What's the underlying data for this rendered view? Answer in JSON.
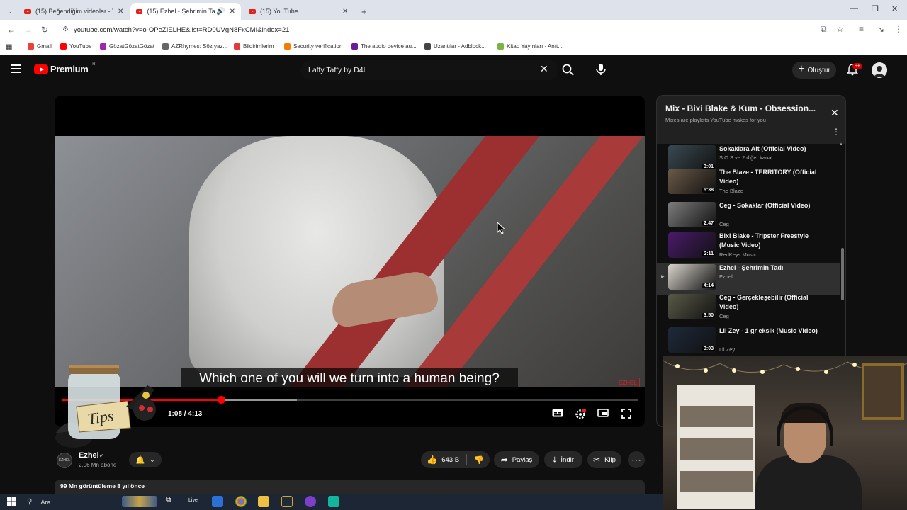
{
  "browser": {
    "tabs": [
      {
        "label": "(15) Beğendiğim videolar - YouTube",
        "active": false
      },
      {
        "label": "(15) Ezhel - Şehrimin Tadı - YouTube",
        "active": true
      },
      {
        "label": "(15) YouTube",
        "active": false
      }
    ],
    "url": "youtube.com/watch?v=o-OPeZIELHE&list=RD0UVgN8FxCMI&index=21",
    "bookmarks": [
      {
        "label": "Gmail",
        "color": "#ea4335"
      },
      {
        "label": "YouTube",
        "color": "#ff0000"
      },
      {
        "label": "GözatGözatGözat",
        "color": "#9c27b0"
      },
      {
        "label": "AZRhymes: Söz yaz...",
        "color": "#666666"
      },
      {
        "label": "Bildirimlerim",
        "color": "#e53935"
      },
      {
        "label": "Security verification",
        "color": "#f57c00"
      },
      {
        "label": "The audio device au...",
        "color": "#6a1b9a"
      },
      {
        "label": "Uzantılar - Adblock...",
        "color": "#444444"
      },
      {
        "label": "Kitap Yayınları - Anıt...",
        "color": "#7cb342"
      }
    ]
  },
  "youtube": {
    "logo_text": "Premium",
    "logo_region": "TR",
    "search_query": "Laffy Taffy by D4L",
    "create_label": "Oluştur",
    "notifications_badge": "9+"
  },
  "player": {
    "subtitle": "Which one of you will we turn into a human being?",
    "watermark": "EZHEL",
    "time_display": "1:08 / 4:13",
    "progress": 0.277,
    "buffered": 0.408,
    "tips_label": "Tips"
  },
  "channel": {
    "avatar_text": "EZHEL",
    "name": "Ezhel",
    "subscribers": "2,06 Mn abone"
  },
  "actions": {
    "likes": "643 B",
    "share": "Paylaş",
    "download": "İndir",
    "clip": "Klip"
  },
  "description": {
    "summary": "99 Mn görüntüleme  8 yıl önce"
  },
  "playlist": {
    "title": "Mix - Bixi Blake & Kum - Obsession...",
    "subtitle": "Mixes are playlists YouTube makes for you",
    "items": [
      {
        "title": "Sokaklara Ait (Official Video)",
        "channel": "S.O.S ve 2 diğer kanal",
        "duration": "3:01",
        "thumb": "#3a4a52"
      },
      {
        "title": "The Blaze - TERRITORY (Official Video)",
        "channel": "The Blaze",
        "duration": "5:38",
        "thumb": "#6b5a48"
      },
      {
        "title": "Ceg - Sokaklar (Official Video)",
        "channel": "Ceg",
        "duration": "2:47",
        "thumb": "#7d7d7d"
      },
      {
        "title": "Bixi Blake - Tripster Freestyle (Music Video)",
        "channel": "RedKeys Music",
        "duration": "2:11",
        "thumb": "#4a1a6a"
      },
      {
        "title": "Ezhel - Şehrimin Tadı",
        "channel": "Ezhel",
        "duration": "4:14",
        "thumb": "#d9d4cc",
        "current": true
      },
      {
        "title": "Ceg - Gerçekleşebilir (Official Video)",
        "channel": "Ceg",
        "duration": "3:50",
        "thumb": "#5a5a48"
      },
      {
        "title": "Lil Zey - 1 gr eksik (Music Video)",
        "channel": "Lil Zey",
        "duration": "3:03",
        "thumb": "#1e2a3a"
      }
    ]
  },
  "taskbar": {
    "search_label": "Ara"
  }
}
